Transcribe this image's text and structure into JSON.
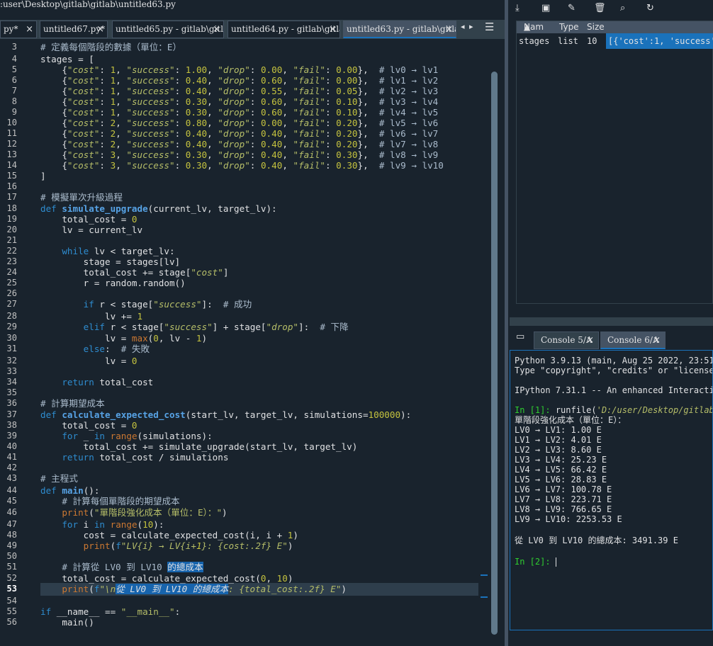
{
  "window": {
    "path": ":user\\Desktop\\gitlab\\gitlab\\untitled63.py"
  },
  "editor_tabs": [
    {
      "label": "py*",
      "active": false
    },
    {
      "label": "untitled67.py*",
      "active": false
    },
    {
      "label": "untitled65.py - gitlab\\gitlab",
      "active": false
    },
    {
      "label": "untitled64.py - gitlab\\gitlab",
      "active": false
    },
    {
      "label": "untitled63.py - gitlab\\gitlab",
      "active": true
    }
  ],
  "editor": {
    "current_line": 53,
    "line_numbers": [
      "3",
      "4",
      "5",
      "6",
      "7",
      "8",
      "9",
      "10",
      "11",
      "12",
      "13",
      "14",
      "15",
      "16",
      "17",
      "18",
      "19",
      "20",
      "21",
      "22",
      "23",
      "24",
      "25",
      "26",
      "27",
      "28",
      "29",
      "30",
      "31",
      "32",
      "33",
      "34",
      "35",
      "36",
      "37",
      "38",
      "39",
      "40",
      "41",
      "42",
      "43",
      "44",
      "45",
      "46",
      "47",
      "48",
      "49",
      "50",
      "51",
      "52",
      "53",
      "54",
      "55",
      "56"
    ],
    "code_lines": [
      "# 定義每個階段的數據（單位：E）",
      "stages = [",
      "    {\"cost\": 1, \"success\": 1.00, \"drop\": 0.00, \"fail\": 0.00},  # lv0 → lv1",
      "    {\"cost\": 1, \"success\": 0.40, \"drop\": 0.60, \"fail\": 0.00},  # lv1 → lv2",
      "    {\"cost\": 1, \"success\": 0.40, \"drop\": 0.55, \"fail\": 0.05},  # lv2 → lv3",
      "    {\"cost\": 1, \"success\": 0.30, \"drop\": 0.60, \"fail\": 0.10},  # lv3 → lv4",
      "    {\"cost\": 1, \"success\": 0.30, \"drop\": 0.60, \"fail\": 0.10},  # lv4 → lv5",
      "    {\"cost\": 2, \"success\": 0.80, \"drop\": 0.00, \"fail\": 0.20},  # lv5 → lv6",
      "    {\"cost\": 2, \"success\": 0.40, \"drop\": 0.40, \"fail\": 0.20},  # lv6 → lv7",
      "    {\"cost\": 2, \"success\": 0.40, \"drop\": 0.40, \"fail\": 0.20},  # lv7 → lv8",
      "    {\"cost\": 3, \"success\": 0.30, \"drop\": 0.40, \"fail\": 0.30},  # lv8 → lv9",
      "    {\"cost\": 3, \"success\": 0.30, \"drop\": 0.40, \"fail\": 0.30},  # lv9 → lv10",
      "]",
      "",
      "# 模擬單次升級過程",
      "def simulate_upgrade(current_lv, target_lv):",
      "    total_cost = 0",
      "    lv = current_lv",
      "",
      "    while lv < target_lv:",
      "        stage = stages[lv]",
      "        total_cost += stage[\"cost\"]",
      "        r = random.random()",
      "",
      "        if r < stage[\"success\"]:  # 成功",
      "            lv += 1",
      "        elif r < stage[\"success\"] + stage[\"drop\"]:  # 下降",
      "            lv = max(0, lv - 1)",
      "        else:  # 失敗",
      "            lv = 0",
      "",
      "    return total_cost",
      "",
      "# 計算期望成本",
      "def calculate_expected_cost(start_lv, target_lv, simulations=100000):",
      "    total_cost = 0",
      "    for _ in range(simulations):",
      "        total_cost += simulate_upgrade(start_lv, target_lv)",
      "    return total_cost / simulations",
      "",
      "# 主程式",
      "def main():",
      "    # 計算每個單階段的期望成本",
      "    print(\"單階段強化成本（單位：E）：\")",
      "    for i in range(10):",
      "        cost = calculate_expected_cost(i, i + 1)",
      "        print(f\"LV{i} → LV{i+1}: {cost:.2f} E\")",
      "",
      "    # 計算從 LV0 到 LV10 的總成本",
      "    total_cost = calculate_expected_cost(0, 10)",
      "    print(f\"\\n從 LV0 到 LV10 的總成本: {total_cost:.2f} E\")",
      "",
      "if __name__ == \"__main__\":",
      "    main()"
    ]
  },
  "variable_explorer": {
    "columns": [
      "Nam",
      "Type",
      "Size"
    ],
    "rows": [
      {
        "name": "stages",
        "type": "list",
        "size": "10",
        "value": "[{'cost':1, 'success'"
      }
    ]
  },
  "console_tabs": [
    {
      "label": "Console 5/A",
      "active": false
    },
    {
      "label": "Console 6/A",
      "active": true
    }
  ],
  "console": {
    "banner1": "Python 3.9.13 (main, Aug 25 2022, 23:51:",
    "banner2": "Type \"copyright\", \"credits\" or \"license\"",
    "banner3": "IPython 7.31.1 -- An enhanced Interactiv",
    "prompt1": "In [1]:",
    "runfile_cmd": "runfile(",
    "runfile_path": "'D:/user/Desktop/gitlab/",
    "header": "單階段強化成本（單位：E）：",
    "results": [
      "LV0 → LV1: 1.00 E",
      "LV1 → LV2: 4.01 E",
      "LV2 → LV3: 8.60 E",
      "LV3 → LV4: 25.23 E",
      "LV4 → LV5: 66.42 E",
      "LV5 → LV6: 28.83 E",
      "LV6 → LV7: 100.78 E",
      "LV7 → LV8: 223.71 E",
      "LV8 → LV9: 766.65 E",
      "LV9 → LV10: 2253.53 E"
    ],
    "total": "從 LV0 到 LV10 的總成本: 3491.39 E",
    "prompt2": "In [2]:"
  }
}
